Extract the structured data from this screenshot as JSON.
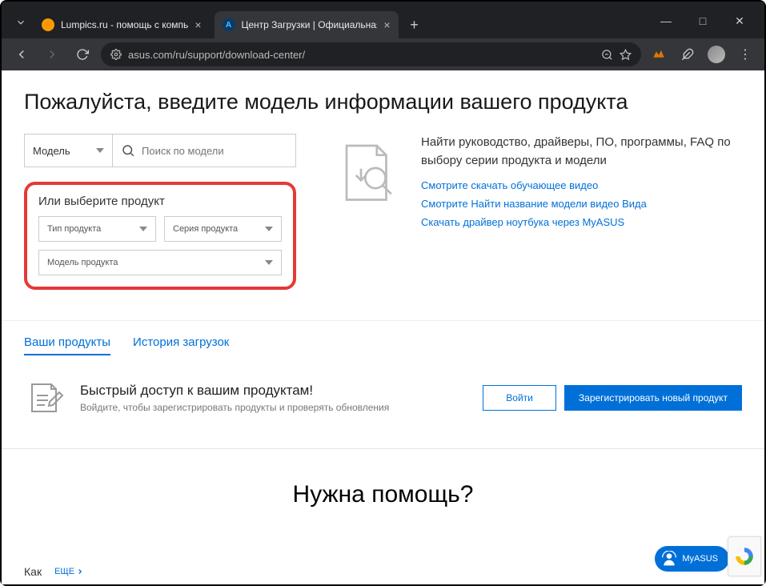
{
  "browser": {
    "tabs": [
      {
        "title": "Lumpics.ru - помощь с компь",
        "favicon": "#ff9800"
      },
      {
        "title": "Центр Загрузки | Официальная",
        "favicon": "#0a3a6b"
      }
    ],
    "url": "asus.com/ru/support/download-center/"
  },
  "page": {
    "title": "Пожалуйста, введите модель информации вашего продукта",
    "model_dropdown": "Модель",
    "search_placeholder": "Поиск по модели",
    "select_section_title": "Или выберите продукт",
    "selects": {
      "type": "Тип продукта",
      "series": "Серия продукта",
      "model": "Модель продукта"
    },
    "info_text": "Найти руководство, драйверы, ПО, программы, FAQ по выбору серии продукта и модели",
    "links": {
      "l1": "Смотрите скачать обучающее видео",
      "l2": "Смотрите Найти название модели видео Вида",
      "l3": "Скачать драйвер ноутбука через MyASUS"
    },
    "tabs": {
      "products": "Ваши продукты",
      "history": "История загрузок"
    },
    "access": {
      "title": "Быстрый доступ к вашим продуктам!",
      "subtitle": "Войдите, чтобы зарегистрировать продукты и проверять обновления",
      "login": "Войти",
      "register": "Зарегистрировать новый продукт"
    },
    "help_title": "Нужна помощь?",
    "bottom": {
      "how": "Как",
      "more": "ЕЩЕ"
    },
    "myasus": "MyASUS"
  }
}
